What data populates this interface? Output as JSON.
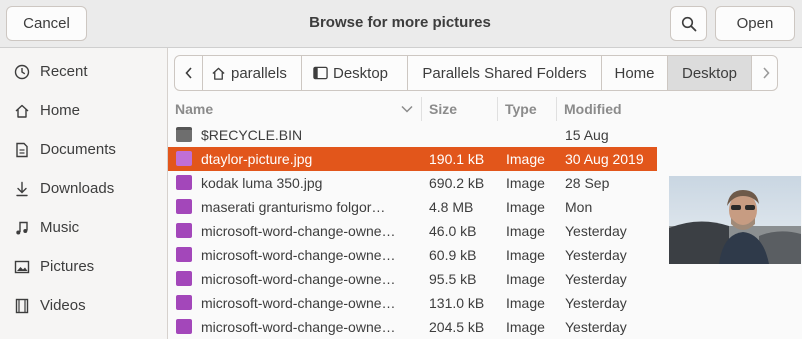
{
  "header": {
    "cancel_label": "Cancel",
    "title": "Browse for more pictures",
    "open_label": "Open"
  },
  "sidebar": {
    "items": [
      {
        "label": "Recent",
        "icon": "clock-icon"
      },
      {
        "label": "Home",
        "icon": "home-icon"
      },
      {
        "label": "Documents",
        "icon": "document-icon"
      },
      {
        "label": "Downloads",
        "icon": "download-icon"
      },
      {
        "label": "Music",
        "icon": "music-note-icon"
      },
      {
        "label": "Pictures",
        "icon": "picture-icon"
      },
      {
        "label": "Videos",
        "icon": "video-icon"
      }
    ]
  },
  "pathbar": {
    "segments": [
      "parallels",
      "Desktop",
      "Parallels Shared Folders",
      "Home",
      "Desktop"
    ],
    "active": "Desktop"
  },
  "columns": {
    "name": "Name",
    "size": "Size",
    "type": "Type",
    "modified": "Modified"
  },
  "files": [
    {
      "name": "$RECYCLE.BIN",
      "size": "",
      "type": "",
      "modified": "15 Aug",
      "kind": "folder"
    },
    {
      "name": "dtaylor-picture.jpg",
      "size": "190.1 kB",
      "type": "Image",
      "modified": "30 Aug 2019",
      "kind": "image",
      "selected": true
    },
    {
      "name": "kodak luma 350.jpg",
      "size": "690.2 kB",
      "type": "Image",
      "modified": "28 Sep",
      "kind": "image"
    },
    {
      "name": "maserati granturismo folgor…",
      "size": "4.8 MB",
      "type": "Image",
      "modified": "Mon",
      "kind": "image"
    },
    {
      "name": "microsoft-word-change-owne…",
      "size": "46.0 kB",
      "type": "Image",
      "modified": "Yesterday",
      "kind": "image"
    },
    {
      "name": "microsoft-word-change-owne…",
      "size": "60.9 kB",
      "type": "Image",
      "modified": "Yesterday",
      "kind": "image"
    },
    {
      "name": "microsoft-word-change-owne…",
      "size": "95.5 kB",
      "type": "Image",
      "modified": "Yesterday",
      "kind": "image"
    },
    {
      "name": "microsoft-word-change-owne…",
      "size": "131.0 kB",
      "type": "Image",
      "modified": "Yesterday",
      "kind": "image"
    },
    {
      "name": "microsoft-word-change-owne…",
      "size": "204.5 kB",
      "type": "Image",
      "modified": "Yesterday",
      "kind": "image"
    }
  ],
  "colors": {
    "selection": "#e2561b",
    "image_icon": "#a347ba",
    "folder_icon": "#6e6e6e"
  }
}
